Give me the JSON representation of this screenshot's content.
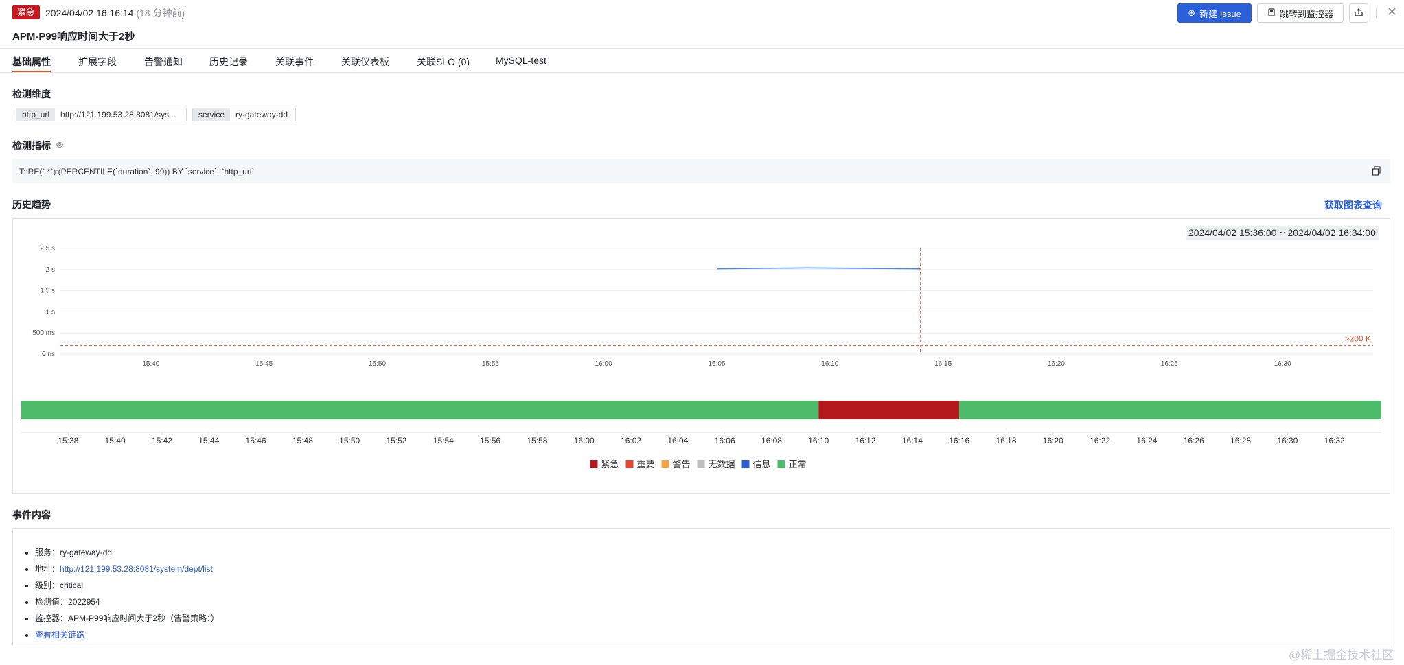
{
  "header": {
    "level_badge": "紧急",
    "time": "2024/04/02 16:16:14",
    "ago": "(18 分钟前)",
    "title": "APM-P99响应时间大于2秒",
    "new_issue_label": "新建 Issue",
    "goto_monitor_label": "跳转到监控器"
  },
  "tabs": [
    {
      "label": "基础属性",
      "active": true
    },
    {
      "label": "扩展字段"
    },
    {
      "label": "告警通知"
    },
    {
      "label": "历史记录"
    },
    {
      "label": "关联事件"
    },
    {
      "label": "关联仪表板"
    },
    {
      "label": "关联SLO (0)"
    },
    {
      "label": "MySQL-test"
    }
  ],
  "dimensions": {
    "title": "检测维度",
    "tags": [
      {
        "key": "http_url",
        "value": "http://121.199.53.28:8081/sys..."
      },
      {
        "key": "service",
        "value": "ry-gateway-dd"
      }
    ]
  },
  "metric": {
    "title": "检测指标",
    "query": "T::RE(`.*`):(PERCENTILE(`duration`, 99)) BY `service`, `http_url`"
  },
  "trend": {
    "title": "历史趋势",
    "get_query_label": "获取图表查询",
    "range_label": "2024/04/02 15:36:00 ~ 2024/04/02 16:34:00"
  },
  "chart_data": [
    {
      "type": "line",
      "y_ticks": [
        "0 ns",
        "500 ms",
        "1 s",
        "1.5 s",
        "2 s",
        "2.5 s"
      ],
      "x_ticks": [
        "15:40",
        "15:45",
        "15:50",
        "15:55",
        "16:00",
        "16:05",
        "16:10",
        "16:15",
        "16:20",
        "16:25",
        "16:30"
      ],
      "ylim_seconds": [
        0,
        2.5
      ],
      "series": [
        {
          "color": "#4a86e8",
          "x": [
            "16:05",
            "16:09",
            "16:14"
          ],
          "y": [
            2.02,
            2.04,
            2.02
          ]
        }
      ],
      "threshold": {
        "label": ">200 K",
        "value_seconds": 0.2,
        "color": "#e55a3a"
      },
      "marker_time": "16:14"
    },
    {
      "type": "bar",
      "x_ticks": [
        "15:38",
        "15:40",
        "15:42",
        "15:44",
        "15:46",
        "15:48",
        "15:50",
        "15:52",
        "15:54",
        "15:56",
        "15:58",
        "16:00",
        "16:02",
        "16:04",
        "16:06",
        "16:08",
        "16:10",
        "16:12",
        "16:14",
        "16:16",
        "16:18",
        "16:20",
        "16:22",
        "16:24",
        "16:26",
        "16:28",
        "16:30",
        "16:32"
      ],
      "segments": [
        {
          "status": "正常",
          "start": "15:36",
          "end": "16:10"
        },
        {
          "status": "紧急",
          "start": "16:10",
          "end": "16:16"
        },
        {
          "status": "正常",
          "start": "16:16",
          "end": "16:34"
        }
      ],
      "legend": [
        {
          "label": "紧急",
          "color": "#b5191d"
        },
        {
          "label": "重要",
          "color": "#e5462d"
        },
        {
          "label": "警告",
          "color": "#f5a340"
        },
        {
          "label": "无数据",
          "color": "#bfbfbf"
        },
        {
          "label": "信息",
          "color": "#2b5fd9"
        },
        {
          "label": "正常",
          "color": "#4cba69"
        }
      ]
    }
  ],
  "event": {
    "title": "事件内容",
    "items": [
      {
        "label": "服务：",
        "value": "ry-gateway-dd"
      },
      {
        "label": "地址：",
        "value": "http://121.199.53.28:8081/system/dept/list",
        "link": true
      },
      {
        "label": "级别：",
        "value": "critical"
      },
      {
        "label": "检测值：",
        "value": "2022954"
      },
      {
        "label": "监控器：",
        "value": "APM-P99响应时间大于2秒（告警策略：）"
      },
      {
        "label": "",
        "value": "查看相关链路",
        "link": true
      }
    ]
  },
  "watermark": "@稀土掘金技术社区"
}
